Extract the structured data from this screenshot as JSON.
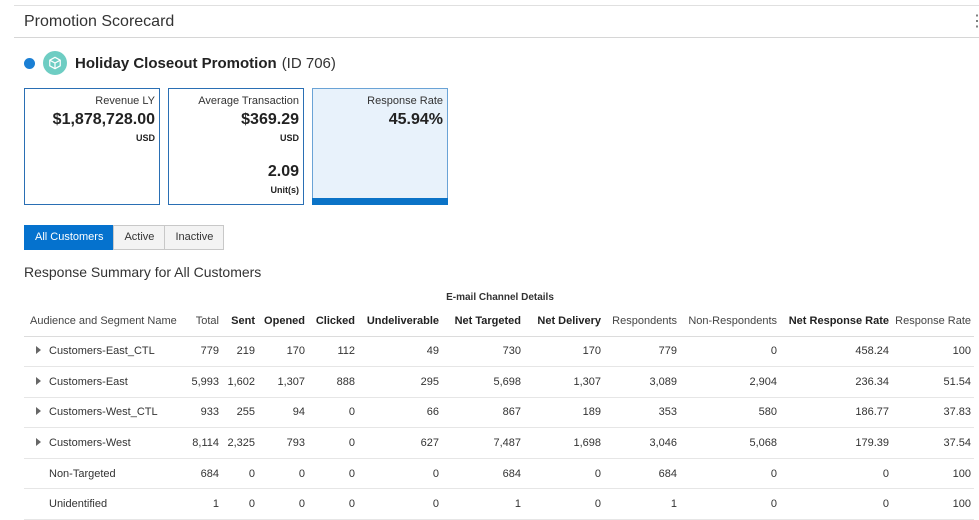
{
  "header": {
    "title": "Promotion Scorecard"
  },
  "promotion": {
    "name": "Holiday Closeout Promotion",
    "id_text": "(ID 706)"
  },
  "cards": {
    "revenue": {
      "label": "Revenue LY",
      "value": "$1,878,728.00",
      "unit": "USD"
    },
    "avg_transaction": {
      "label": "Average Transaction",
      "value": "$369.29",
      "unit": "USD",
      "value2": "2.09",
      "unit2": "Unit(s)"
    },
    "response_rate": {
      "label": "Response Rate",
      "value": "45.94%"
    }
  },
  "tabs": [
    "All Customers",
    "Active",
    "Inactive"
  ],
  "active_tab": "All Customers",
  "section_title": "Response Summary for All Customers",
  "table": {
    "group_header": "E-mail Channel Details",
    "columns": [
      "Audience and Segment Name",
      "Total",
      "Sent",
      "Opened",
      "Clicked",
      "Undeliverable",
      "Net Targeted",
      "Net Delivery",
      "Respondents",
      "Non-Respondents",
      "Net Response Rate",
      "Response Rate"
    ],
    "rows": [
      [
        "Customers-East_CTL",
        "779",
        "219",
        "170",
        "112",
        "49",
        "730",
        "170",
        "779",
        "0",
        "458.24",
        "100"
      ],
      [
        "Customers-East",
        "5,993",
        "1,602",
        "1,307",
        "888",
        "295",
        "5,698",
        "1,307",
        "3,089",
        "2,904",
        "236.34",
        "51.54"
      ],
      [
        "Customers-West_CTL",
        "933",
        "255",
        "94",
        "0",
        "66",
        "867",
        "189",
        "353",
        "580",
        "186.77",
        "37.83"
      ],
      [
        "Customers-West",
        "8,114",
        "2,325",
        "793",
        "0",
        "627",
        "7,487",
        "1,698",
        "3,046",
        "5,068",
        "179.39",
        "37.54"
      ],
      [
        "Non-Targeted",
        "684",
        "0",
        "0",
        "0",
        "0",
        "684",
        "0",
        "684",
        "0",
        "0",
        "100"
      ],
      [
        "Unidentified",
        "1",
        "0",
        "0",
        "0",
        "0",
        "1",
        "0",
        "1",
        "0",
        "0",
        "100"
      ]
    ]
  },
  "colors": {
    "accent": "#0572ce",
    "card_border": "#2a6fb4",
    "selected_card_bg": "#e8f2fb",
    "promo_dot": "#1a7fd4",
    "promo_icon": "#6ecdc3"
  }
}
